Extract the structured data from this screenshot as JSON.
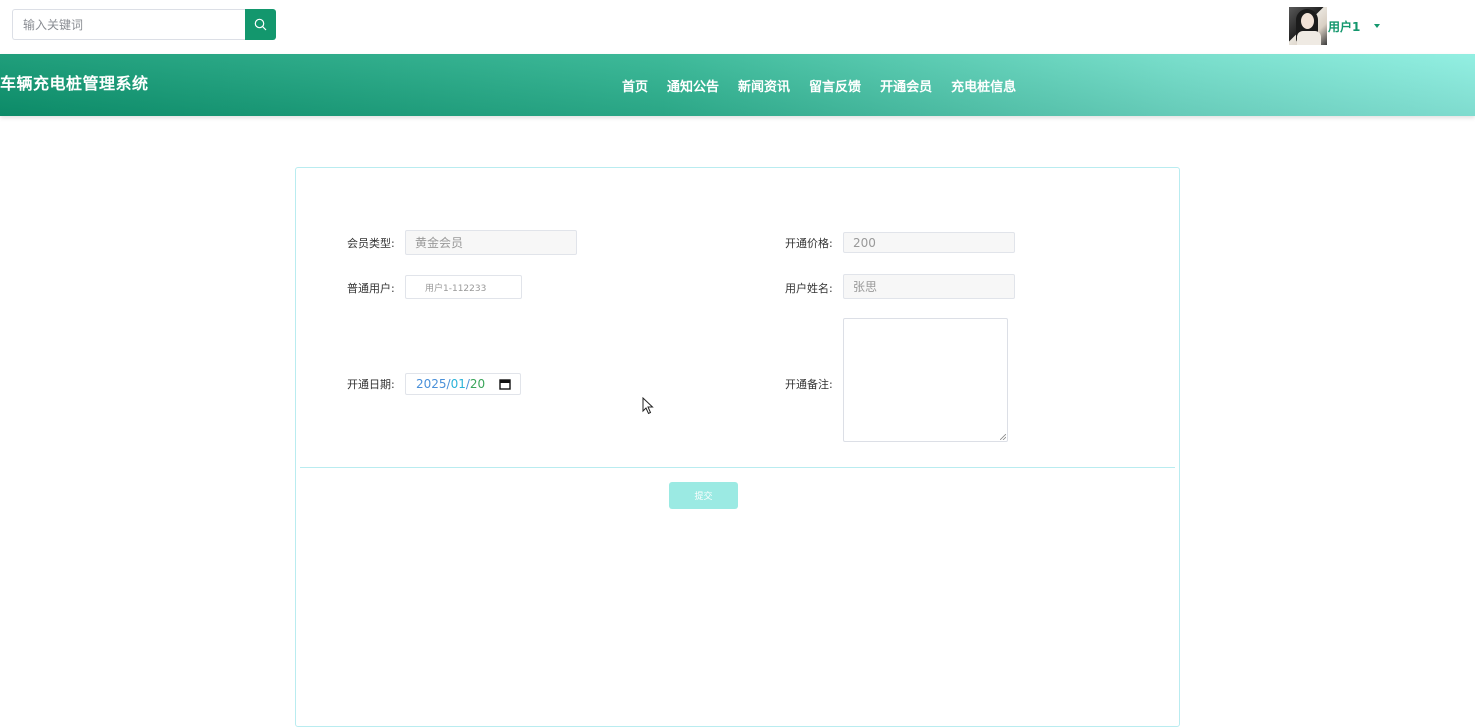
{
  "header": {
    "search_placeholder": "输入关键词",
    "user_name": "用户1"
  },
  "nav": {
    "brand": "车辆充电桩管理系统",
    "links": [
      "首页",
      "通知公告",
      "新闻资讯",
      "留言反馈",
      "开通会员",
      "充电桩信息"
    ]
  },
  "form": {
    "member_type_label": "会员类型:",
    "member_type_value": "黄金会员",
    "price_label": "开通价格:",
    "price_value": "200",
    "user_label": "普通用户:",
    "user_value": "用户1-112233",
    "name_label": "用户姓名:",
    "name_value": "张思",
    "date_label": "开通日期:",
    "date_year": "2025",
    "date_month": "01",
    "date_day": "20",
    "remark_label": "开通备注:",
    "remark_value": "",
    "submit_label": "提交"
  },
  "colors": {
    "accent": "#13976d",
    "nav_gradient_start": "#0d9670",
    "nav_gradient_end": "#8aeee0",
    "border": "#b9ecf0",
    "submit_bg": "#9beae3"
  }
}
